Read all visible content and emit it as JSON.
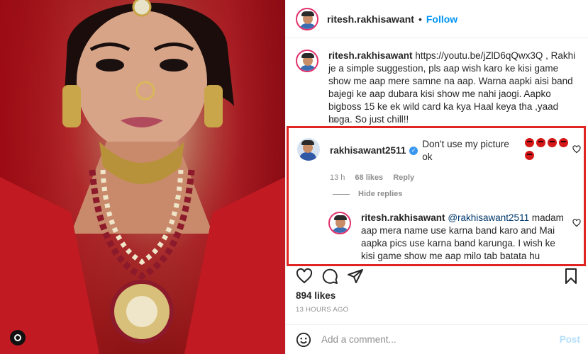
{
  "post": {
    "author": "ritesh.rakhisawant",
    "separator": "•",
    "follow_label": "Follow"
  },
  "caption": {
    "author": "ritesh.rakhisawant",
    "text": "https://youtu.be/jZlD6qQwx3Q , Rakhi je a simple suggestion, pls aap wish karo ke kisi game show me aap mere samne na aap. Warna aapki aisi band bajegi ke aap dubara kisi show me nahi jaogi. Aapko bigboss 15 ke ek wild card ka kya Haal keya tha ,yaad hoga. So just chill!!",
    "time": "13 h"
  },
  "comments": [
    {
      "author": "rakhisawant2511",
      "verified": true,
      "text": "Don't use my picture ok",
      "emoji": [
        "angry-face",
        "angry-face",
        "angry-face",
        "angry-face",
        "angry-face"
      ],
      "time": "13 h",
      "likes": "68 likes",
      "reply_label": "Reply"
    }
  ],
  "hide_replies_label": "Hide replies",
  "reply": {
    "author": "ritesh.rakhisawant",
    "mention": "@rakhisawant2511",
    "text": "madam aap mera name use karna band karo and Mai aapka pics use karna band karunga. I wish ke kisi game show me aap milo tab batata hu aapko. Band kiski baiti hai pata"
  },
  "actions": {
    "icons": [
      "heart-icon",
      "comment-icon",
      "share-icon",
      "bookmark-icon"
    ]
  },
  "likes": "894 likes",
  "posted": "13 HOURS AGO",
  "comment_input": {
    "placeholder": "Add a comment...",
    "post_label": "Post"
  },
  "colors": {
    "accent": "#0095f6",
    "highlight_border": "#e02424",
    "muted": "#8e8e8e"
  }
}
